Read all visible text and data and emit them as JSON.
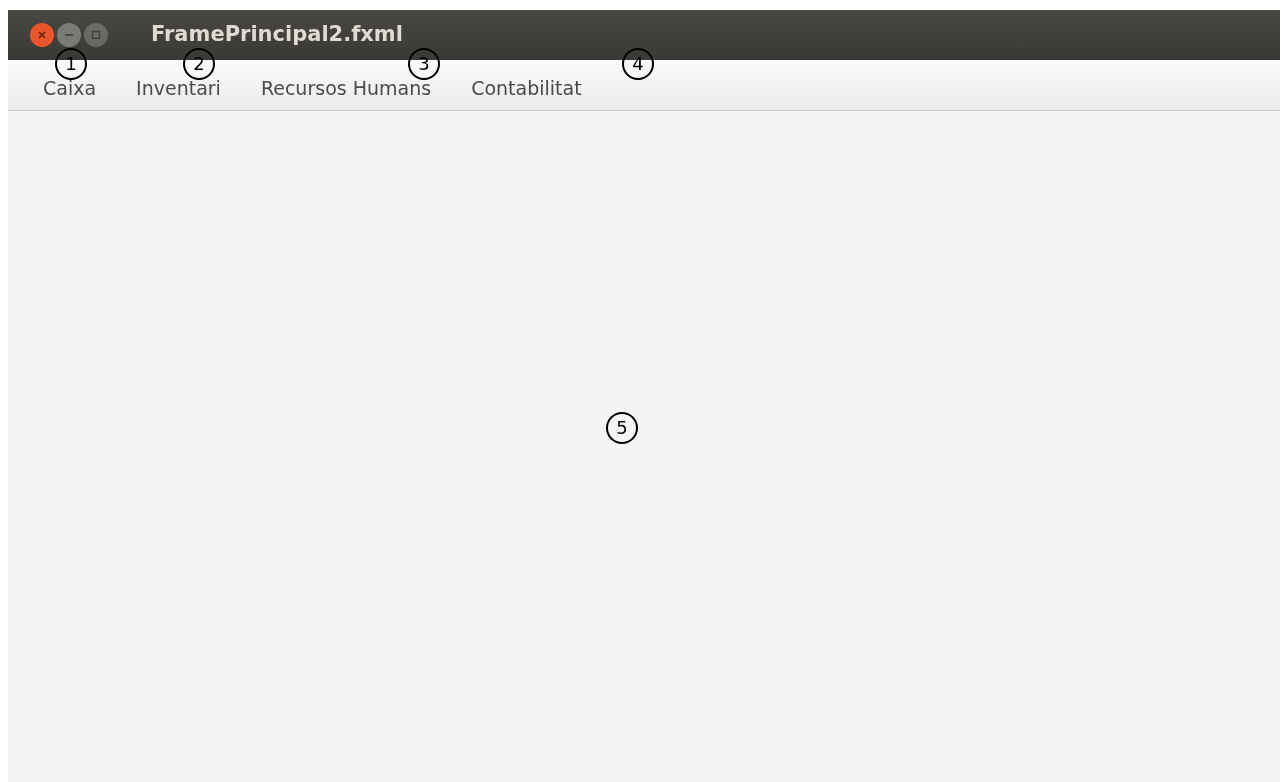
{
  "window": {
    "title": "FramePrincipal2.fxml"
  },
  "menu_bar": {
    "items": [
      {
        "label": "Caixa"
      },
      {
        "label": "Inventari"
      },
      {
        "label": "Recursos Humans"
      },
      {
        "label": "Contabilitat"
      }
    ]
  },
  "callouts": [
    {
      "label": "1"
    },
    {
      "label": "2"
    },
    {
      "label": "3"
    },
    {
      "label": "4"
    },
    {
      "label": "5"
    }
  ]
}
